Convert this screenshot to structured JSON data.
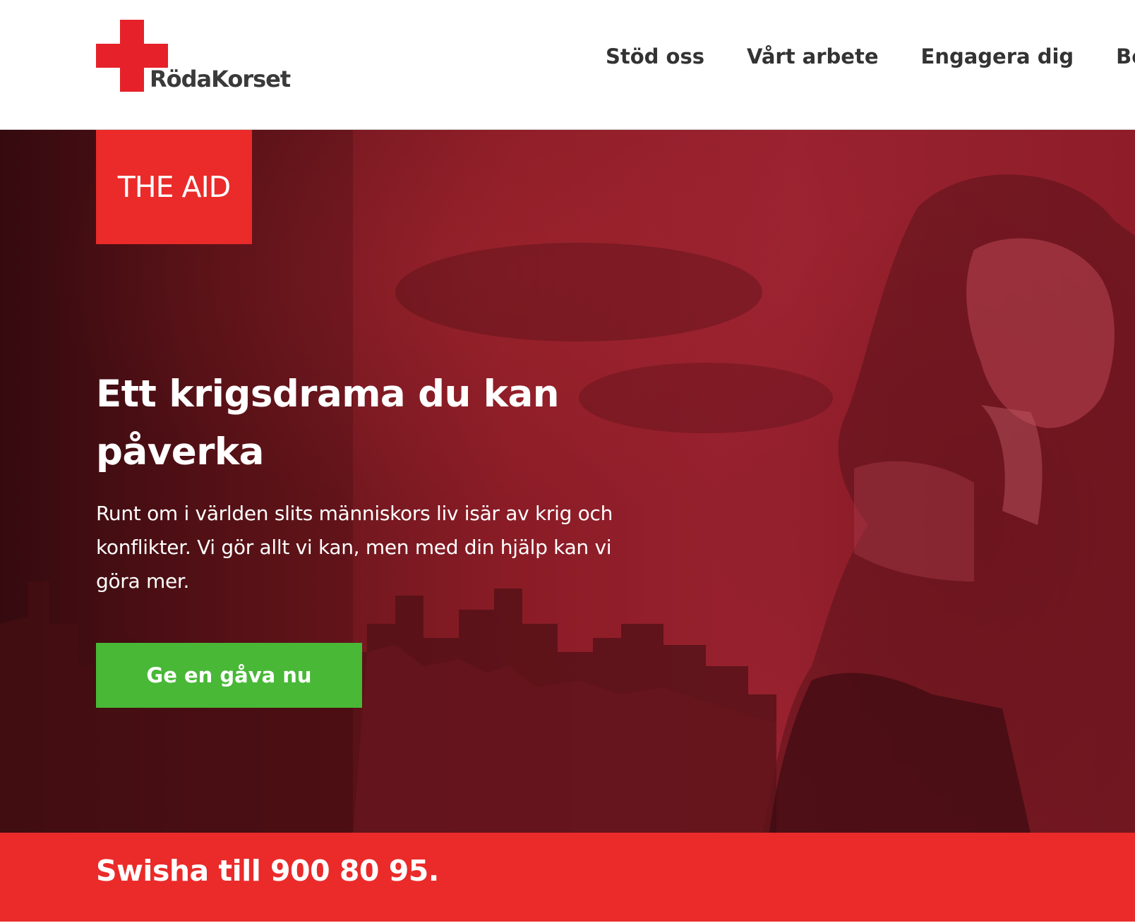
{
  "header": {
    "logo_text": "RödaKorset",
    "nav": [
      {
        "label": "Stöd oss"
      },
      {
        "label": "Vårt arbete"
      },
      {
        "label": "Engagera dig"
      },
      {
        "label": "Behö"
      }
    ]
  },
  "hero": {
    "tag": "THE AID",
    "title": "Ett krigsdrama du kan påverka",
    "text": "Runt om i världen slits människors liv isär av krig och konflikter. Vi gör allt vi kan, men med din hjälp kan vi göra mer.",
    "cta_label": "Ge en gåva nu"
  },
  "swish": {
    "text": "Swisha till 900 80 95."
  },
  "colors": {
    "brand_red": "#ea2b2a",
    "cross_red": "#e6212a",
    "cta_green": "#48b836",
    "nav_text": "#333333",
    "hero_tint": "#8a1c26"
  },
  "icons": {
    "logo_mark": "red-cross-icon"
  }
}
